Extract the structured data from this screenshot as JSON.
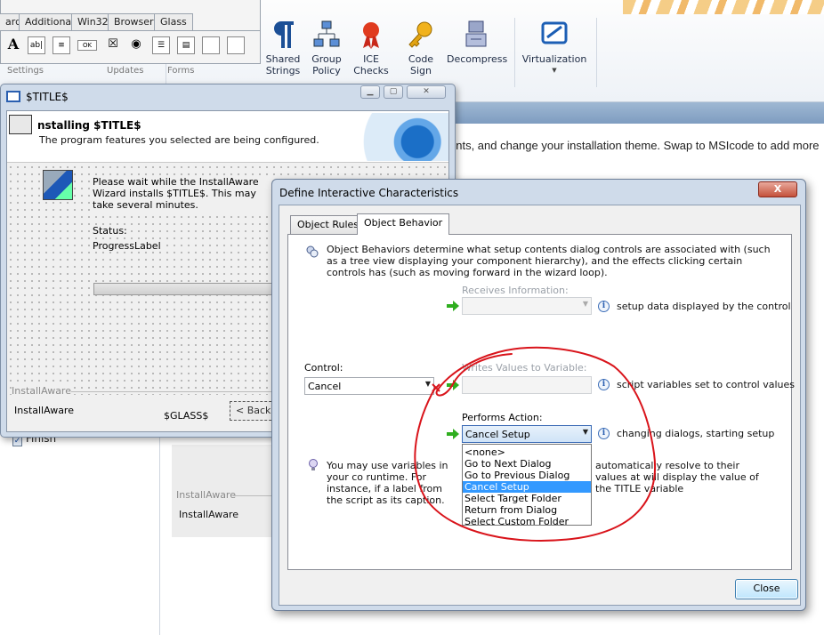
{
  "ribbon": {
    "toolbox_tabs": [
      "ard",
      "Additional",
      "Win32",
      "Browser",
      "Glass"
    ],
    "group_labels": {
      "settings": "Settings",
      "updates": "Updates",
      "forms": "Forms"
    },
    "buttons": [
      {
        "label": "Shared\nStrings",
        "icon": "pilcrow-icon"
      },
      {
        "label": "Group\nPolicy",
        "icon": "network-icon"
      },
      {
        "label": "ICE\nChecks",
        "icon": "ribbon-award-icon"
      },
      {
        "label": "Code\nSign",
        "icon": "key-icon"
      },
      {
        "label": "Decompress",
        "icon": "decompress-icon"
      },
      {
        "label": "Virtualization",
        "icon": "virtualization-icon"
      }
    ]
  },
  "background": {
    "description": "ents, and change your installation theme. Swap to MSIcode to add more",
    "finish_label": "Finish",
    "ia_label": "InstallAware",
    "ia_value": "InstallAware"
  },
  "wizard": {
    "window_title": "$TITLE$",
    "header_title": "nstalling $TITLE$",
    "header_subtitle": "The program features you selected are being configured.",
    "wait_text": "Please wait while the InstallAware Wizard installs $TITLE$. This may take several minutes.",
    "status_label": "Status:",
    "progress_label": "ProgressLabel",
    "ia_label": "InstallAware",
    "ia_value": "InstallAware",
    "glass_text": "$GLASS$",
    "back_button": "< Back"
  },
  "dialog": {
    "title": "Define Interactive Characteristics",
    "tabs": [
      "Object Rules",
      "Object Behavior"
    ],
    "active_tab": "Object Behavior",
    "info_text": "Object Behaviors determine what setup contents dialog controls are associated with (such as a tree view displaying your component hierarchy), and the effects clicking certain controls has (such as moving forward in the wizard loop).",
    "receives_label": "Receives Information:",
    "receives_hint": "setup data displayed by the control",
    "control_label": "Control:",
    "control_value": "Cancel",
    "writes_label": "Writes Values to Variable:",
    "writes_hint": "script variables set to control values",
    "performs_label": "Performs Action:",
    "performs_value": "Cancel Setup",
    "performs_hint": "changing dialogs, starting setup",
    "action_options": [
      "<none>",
      "Go to Next Dialog",
      "Go to Previous Dialog",
      "Cancel Setup",
      "Select Target Folder",
      "Return from Dialog",
      "Select Custom Folder"
    ],
    "selected_option": "Cancel Setup",
    "tip_left": "You may use variables in your co runtime. For instance, if a label from the script as its caption.",
    "tip_right": "automatically resolve to their values at will display the value of the TITLE variable",
    "close_button": "Close",
    "close_x": "X"
  },
  "colors": {
    "annotation": "#d9141b",
    "accent": "#3399ff",
    "arrow": "#2fae1f"
  }
}
